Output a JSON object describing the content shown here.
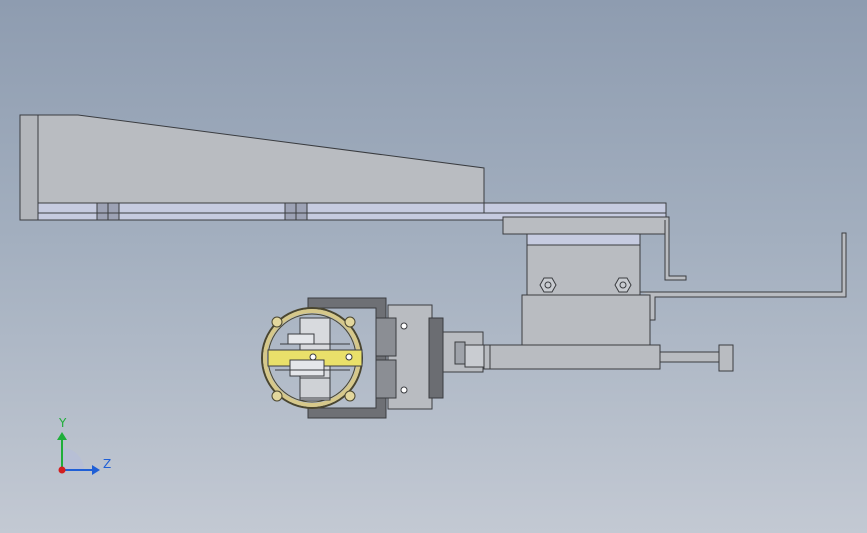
{
  "viewport": {
    "background_top": "#8e9cb0",
    "background_bottom": "#c3c9d3"
  },
  "triad": {
    "y_label": "Y",
    "z_label": "Z",
    "y_color": "#1fae3a",
    "z_color": "#1f5fd6",
    "x_color": "#d21f1f"
  },
  "colors": {
    "part_gray": "#b9bcc1",
    "plate_blue": "#c6cbe0",
    "dark_part": "#6b6d72",
    "brass": "#d6c88a",
    "accent_yellow": "#e9e06a"
  }
}
